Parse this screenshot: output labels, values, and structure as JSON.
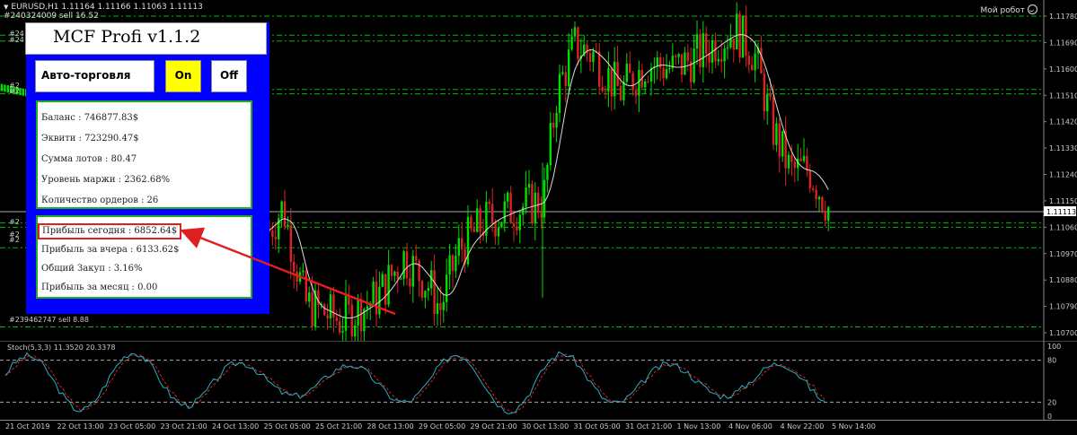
{
  "chart": {
    "symbol_info": "EURUSD,H1  1.11164 1.11166 1.11063 1.11113",
    "order_info": "#240324009 sell 16.52",
    "robot_label": "Мой робот",
    "current_price": "1.11113",
    "price_labels": [
      "1.11780",
      "1.11690",
      "1.11600",
      "1.11510",
      "1.11420",
      "1.11330",
      "1.11240",
      "1.11150",
      "1.11060",
      "1.10970",
      "1.10880",
      "1.10790",
      "1.10700"
    ],
    "side_order_tags": [
      "#24",
      "#24",
      "#2",
      "#2",
      "#2",
      "#2",
      "#2"
    ],
    "bottom_order_tag": "#239462747 sell 8.88",
    "colors": {
      "bull": "#00dd00",
      "bear": "#dd2222",
      "ma": "#dcdcdc",
      "level": "#00bb00",
      "stoch_main": "#20b2c8",
      "stoch_signal": "#dd2222"
    }
  },
  "stochastic": {
    "label": "Stoch(5,3,3) 11.3520 20.3378",
    "scale_labels": [
      "100",
      "80",
      "20",
      "0"
    ]
  },
  "time_axis": [
    "21 Oct 2019",
    "22 Oct 13:00",
    "23 Oct 05:00",
    "23 Oct 21:00",
    "24 Oct 13:00",
    "25 Oct 05:00",
    "25 Oct 21:00",
    "28 Oct 13:00",
    "29 Oct 05:00",
    "29 Oct 21:00",
    "30 Oct 13:00",
    "31 Oct 05:00",
    "31 Oct 21:00",
    "1 Nov 13:00",
    "4 Nov 06:00",
    "4 Nov 22:00",
    "5 Nov 14:00"
  ],
  "panel": {
    "title": "MCF Profi v1.1.2",
    "auto_trading_label": "Авто-торговля",
    "on_label": "On",
    "off_label": "Off",
    "stats": [
      "Баланс : 746877.83$",
      "Эквити : 723290.47$",
      "Сумма лотов : 80.47",
      "Уровень маржи : 2362.68%",
      "Количество ордеров : 26"
    ],
    "profit_today": "Прибыль сегодня : 6852.64$",
    "profits": [
      "Прибыль за вчера : 6133.62$",
      "Общий Закуп : 3.16%",
      "Прибыль за месяц : 0.00"
    ]
  }
}
